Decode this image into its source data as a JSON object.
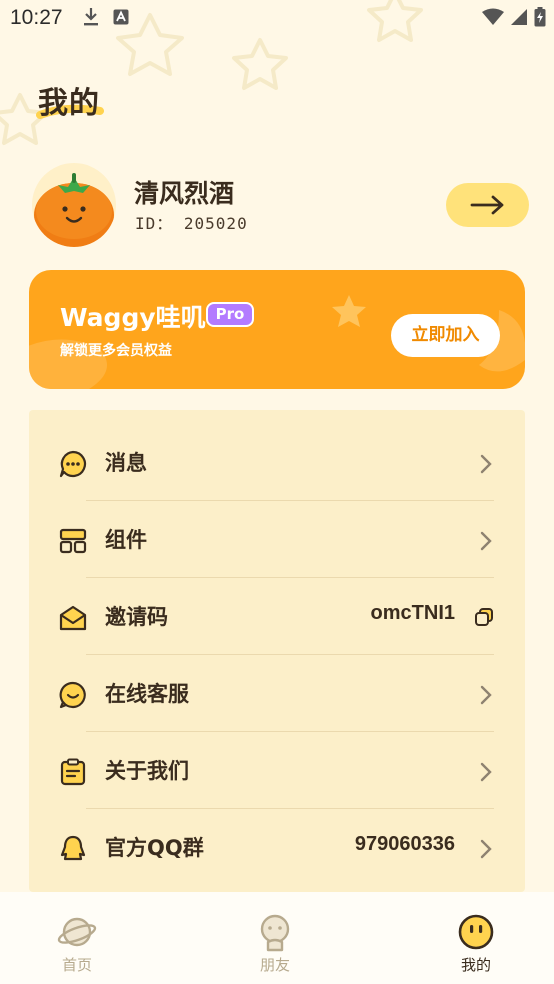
{
  "status_bar": {
    "time": "10:27"
  },
  "page": {
    "title": "我的"
  },
  "profile": {
    "name": "清风烈酒",
    "id_text": "ID： 205020"
  },
  "vip": {
    "title": "Waggy哇叽",
    "badge": "Pro",
    "subtitle": "解锁更多会员权益",
    "button": "立即加入"
  },
  "menu": [
    {
      "label": "消息",
      "value": "",
      "icon": "message-bubble-icon",
      "action": "chevron"
    },
    {
      "label": "组件",
      "value": "",
      "icon": "widget-grid-icon",
      "action": "chevron"
    },
    {
      "label": "邀请码",
      "value": "omcTNI1",
      "icon": "envelope-icon",
      "action": "copy"
    },
    {
      "label": "在线客服",
      "value": "",
      "icon": "smile-chat-icon",
      "action": "chevron"
    },
    {
      "label": "关于我们",
      "value": "",
      "icon": "clipboard-icon",
      "action": "chevron"
    },
    {
      "label": "官方QQ群",
      "value": "979060336",
      "icon": "qq-penguin-icon",
      "action": "chevron"
    }
  ],
  "nav": [
    {
      "label": "首页",
      "icon": "planet-icon",
      "active": false
    },
    {
      "label": "朋友",
      "icon": "friend-face-icon",
      "active": false
    },
    {
      "label": "我的",
      "icon": "smiley-face-icon",
      "active": true
    }
  ],
  "colors": {
    "background": "#FFF8E6",
    "accent_orange": "#FFA51C",
    "accent_yellow": "#FFE27A",
    "menu_card": "#FCEFC9",
    "text_dark": "#3A2C1E",
    "pro_purple": "#B37BFF"
  }
}
